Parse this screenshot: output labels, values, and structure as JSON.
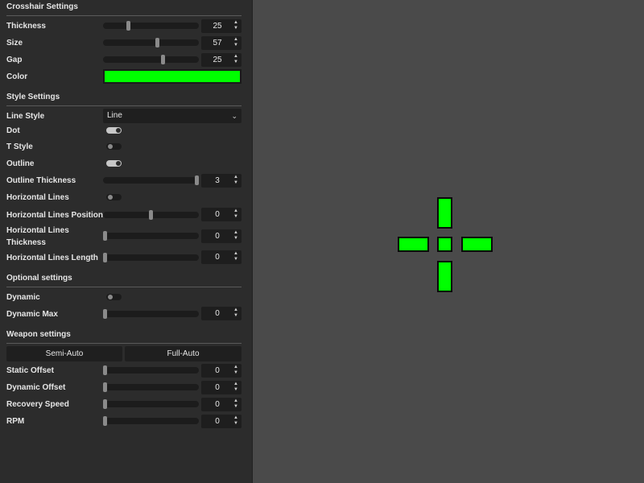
{
  "sections": {
    "crosshair": "Crosshair Settings",
    "style": "Style Settings",
    "optional": "Optional settings",
    "weapon": "Weapon settings"
  },
  "crosshair": {
    "thickness": {
      "label": "Thickness",
      "value": "25",
      "level": 0.25
    },
    "size": {
      "label": "Size",
      "value": "57",
      "level": 0.57
    },
    "gap": {
      "label": "Gap",
      "value": "25",
      "level": 0.63
    },
    "color": {
      "label": "Color",
      "value": "#00ff00"
    }
  },
  "style": {
    "line_style": {
      "label": "Line Style",
      "value": "Line"
    },
    "dot": {
      "label": "Dot",
      "on": true
    },
    "t_style": {
      "label": "T Style",
      "on": false
    },
    "outline": {
      "label": "Outline",
      "on": true
    },
    "outline_thickness": {
      "label": "Outline Thickness",
      "value": "3",
      "level": 1.0
    },
    "horizontal_lines": {
      "label": "Horizontal Lines",
      "on": false
    },
    "hl_position": {
      "label": "Horizontal Lines Position",
      "value": "0",
      "level": 0.5
    },
    "hl_thickness": {
      "label_1": "Horizontal Lines",
      "label_2": "Thickness",
      "value": "0",
      "level": 0
    },
    "hl_length": {
      "label": "Horizontal Lines Length",
      "value": "0",
      "level": 0
    }
  },
  "optional": {
    "dynamic": {
      "label": "Dynamic",
      "on": false
    },
    "dynamic_max": {
      "label": "Dynamic Max",
      "value": "0",
      "level": 0
    }
  },
  "weapon": {
    "tabs": [
      "Semi-Auto",
      "Full-Auto"
    ],
    "static_offset": {
      "label": "Static Offset",
      "value": "0",
      "level": 0
    },
    "dynamic_offset": {
      "label": "Dynamic Offset",
      "value": "0",
      "level": 0
    },
    "recovery_speed": {
      "label": "Recovery Speed",
      "value": "0",
      "level": 0
    },
    "rpm": {
      "label": "RPM",
      "value": "0",
      "level": 0
    }
  },
  "icons": {
    "spin": "up-down-arrows-icon",
    "select": "chevron-down-icon"
  }
}
